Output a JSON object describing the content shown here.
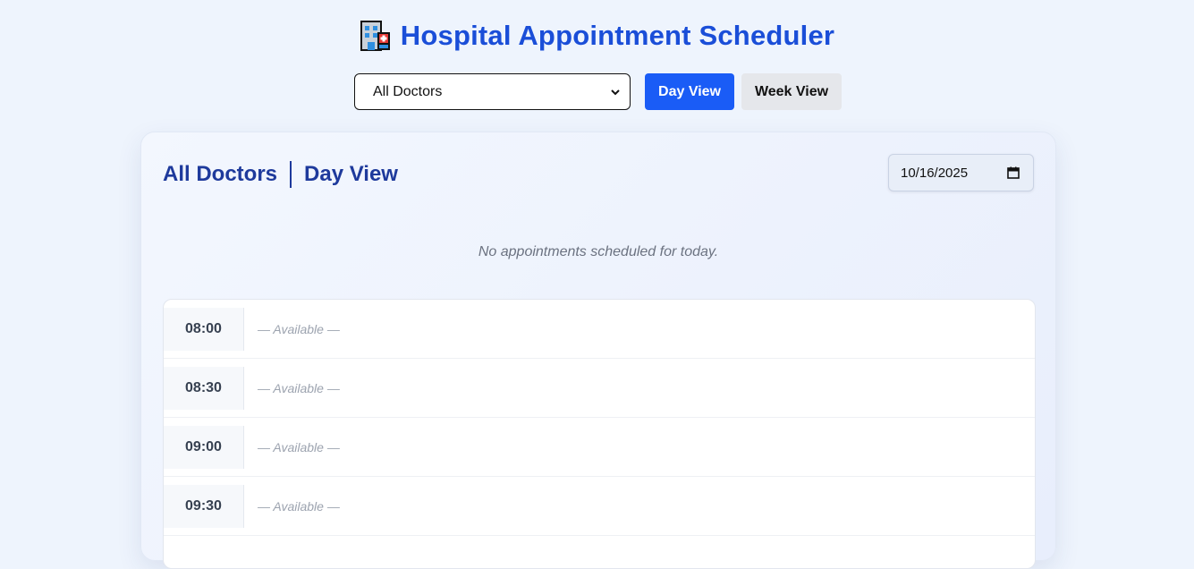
{
  "app": {
    "title": "Hospital Appointment Scheduler",
    "title_icon": "hospital-icon"
  },
  "controls": {
    "doctor_select": {
      "selected": "All Doctors"
    },
    "day_view_label": "Day View",
    "week_view_label": "Week View",
    "active_view": "Day View"
  },
  "panel": {
    "doctor_title": "All Doctors",
    "view_title": "Day View",
    "date_value": "10/16/2025",
    "empty_message": "No appointments scheduled for today."
  },
  "slots": [
    {
      "time": "08:00",
      "status": "— Available —"
    },
    {
      "time": "08:30",
      "status": "— Available —"
    },
    {
      "time": "09:00",
      "status": "— Available —"
    },
    {
      "time": "09:30",
      "status": "— Available —"
    }
  ],
  "colors": {
    "accent": "#1a5cf6",
    "title": "#1a4ed8",
    "panel_heading": "#1e3a9c",
    "background": "#eef4fd"
  }
}
